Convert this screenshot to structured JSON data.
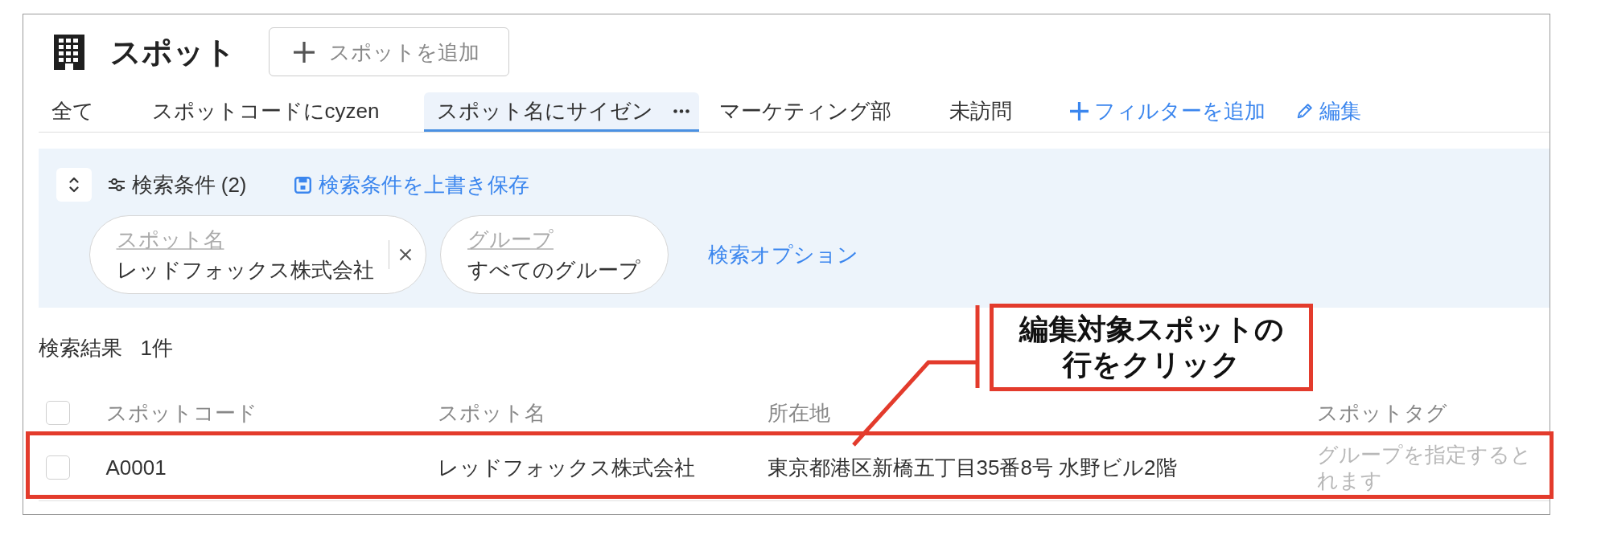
{
  "header": {
    "title": "スポット",
    "add_button": "スポットを追加"
  },
  "tabs": [
    {
      "label": "全て",
      "selected": false
    },
    {
      "label": "スポットコードにcyzen",
      "selected": false
    },
    {
      "label": "スポット名にサイゼン",
      "selected": true
    },
    {
      "label": "マーケティング部",
      "selected": false
    },
    {
      "label": "未訪問",
      "selected": false
    }
  ],
  "tab_actions": [
    {
      "kind": "add",
      "label": "フィルターを追加"
    },
    {
      "kind": "edit",
      "label": "編集"
    }
  ],
  "search_panel": {
    "conditions": "検索条件 (2)",
    "save_link": "検索条件を上書き保存",
    "fields": [
      {
        "label": "スポット名",
        "value": "レッドフォックス株式会社",
        "clearable": true
      },
      {
        "label": "グループ",
        "value": "すべてのグループ",
        "clearable": false
      }
    ],
    "options_link": "検索オプション"
  },
  "results": {
    "label": "検索結果",
    "count": "1件"
  },
  "table": {
    "header_checked": false,
    "columns": [
      "スポットコード",
      "スポット名",
      "所在地",
      "スポットタグ"
    ],
    "rows": [
      {
        "checked": false,
        "cells": [
          "A0001",
          "レッドフォックス株式会社",
          "東京都港区新橋五丁目35番8号 水野ビル2階"
        ],
        "tag_hint_lines": [
          "グループを指定すると",
          "れます"
        ]
      }
    ]
  },
  "annotation": {
    "callout": "編集対象スポットの行をクリック"
  }
}
